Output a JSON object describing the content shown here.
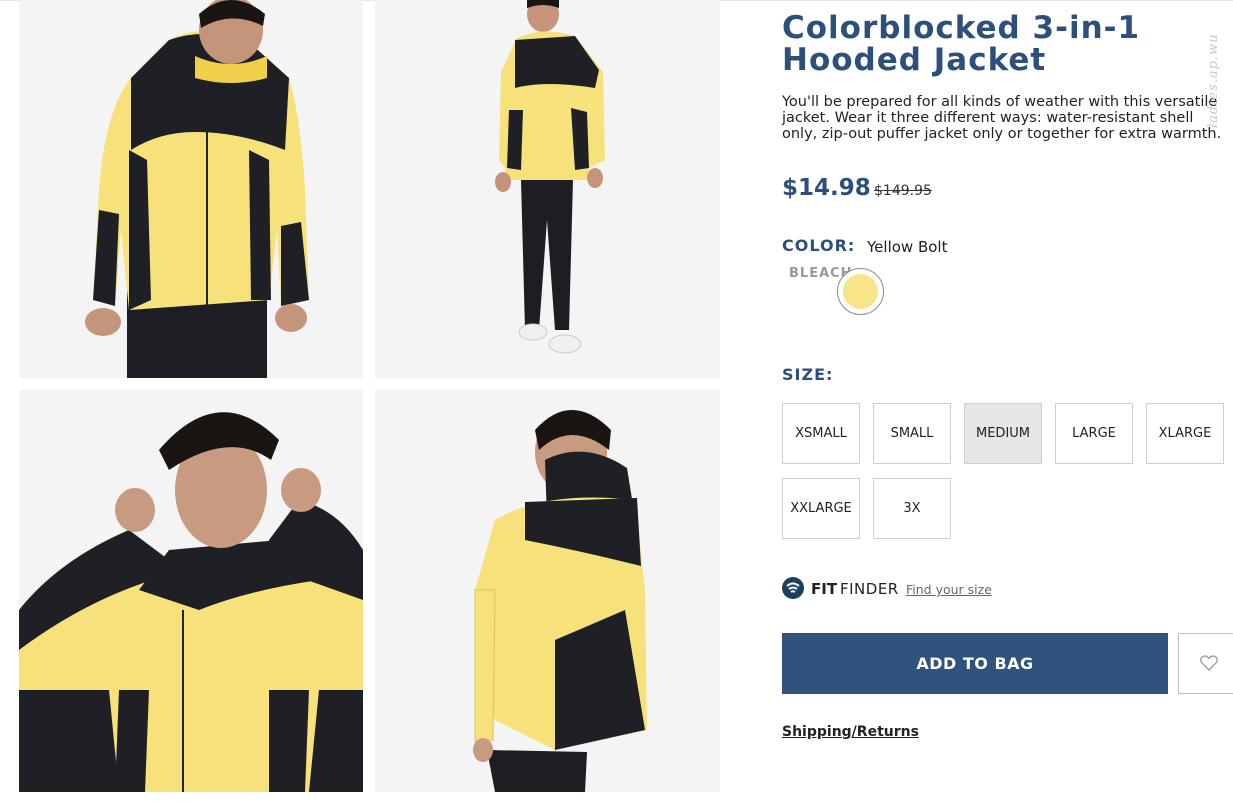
{
  "product": {
    "title": "Colorblocked 3-in-1 Hooded Jacket",
    "description": "You'll be prepared for all kinds of weather with this versatile jacket. Wear it three different ways: water-resistant shell only, zip-out puffer jacket only or together for extra warmth.",
    "price": "$14.98",
    "original_price": "$149.95",
    "watermark": "ladies.ap.wu"
  },
  "gallery": {
    "images": [
      {
        "alt": "Front view of yellow and black hooded jacket"
      },
      {
        "alt": "Full body front view of model in jacket"
      },
      {
        "alt": "Model adjusting hood of jacket"
      },
      {
        "alt": "Back view of yellow and black jacket"
      }
    ]
  },
  "color": {
    "label": "COLOR:",
    "selected": "Yellow Bolt",
    "family": "BLEACH",
    "swatch_hex": "#f8e58a"
  },
  "size": {
    "label": "SIZE:",
    "options": [
      "XSMALL",
      "SMALL",
      "MEDIUM",
      "LARGE",
      "XLARGE",
      "XXLARGE",
      "3X"
    ],
    "selected": "MEDIUM"
  },
  "fit_finder": {
    "brand_bold": "FIT",
    "brand_light": "FINDER",
    "link": "Find your size",
    "icon": "fit-finder-icon"
  },
  "actions": {
    "add_to_bag": "ADD TO BAG",
    "wishlist_icon": "heart-icon",
    "shipping": "Shipping/Returns"
  },
  "colors": {
    "brand_navy": "#2d4f7c",
    "button_navy": "#2f537d",
    "jacket_yellow": "#f7e17a",
    "jacket_black": "#1f2026",
    "selected_size_bg": "#e6e6e6"
  }
}
